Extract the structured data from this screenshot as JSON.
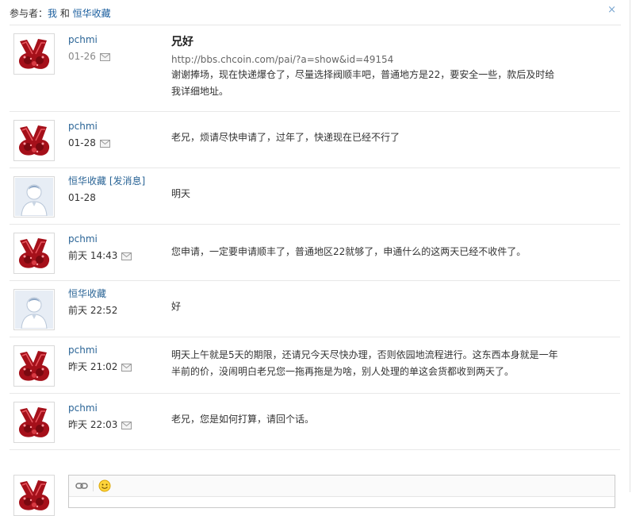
{
  "header": {
    "participants_label": "参与者：",
    "me": "我",
    "and": " 和 ",
    "other": "恒华收藏",
    "close_symbol": "×"
  },
  "messages": [
    {
      "sender": "pchmi",
      "date": "01-26",
      "subject": "兄好",
      "link": "http://bbs.chcoin.com/pai/?a=show&id=49154",
      "text_lines": [
        "谢谢捧场，现在快递爆仓了，尽量选择阀顺丰吧，普通地方是22，要安全一些，款后及时给",
        "我详细地址。"
      ],
      "avatar": "hand-avatar"
    },
    {
      "sender": "pchmi",
      "date": "01-28",
      "text_lines": [
        "老兄，烦请尽快申请了，过年了，快递现在已经不行了"
      ],
      "avatar": "hand-avatar"
    },
    {
      "sender": "恒华收藏",
      "send_link": " [发消息]",
      "date": "01-28",
      "text_lines": [
        "明天"
      ],
      "avatar": "default-avatar"
    },
    {
      "sender": "pchmi",
      "date": "前天 14:43",
      "text_lines": [
        "您申请，一定要申请顺丰了，普通地区22就够了，申通什么的这两天已经不收件了。"
      ],
      "avatar": "hand-avatar"
    },
    {
      "sender": "恒华收藏",
      "date": "前天 22:52",
      "text_lines": [
        "好"
      ],
      "avatar": "default-avatar"
    },
    {
      "sender": "pchmi",
      "date": "昨天 21:02",
      "text_lines": [
        "明天上午就是5天的期限，还请兄今天尽快办理，否则依园地流程进行。这东西本身就是一年",
        "半前的价，没闹明白老兄您一拖再拖是为啥，别人处理的单这会货都收到两天了。"
      ],
      "avatar": "hand-avatar"
    },
    {
      "sender": "pchmi",
      "date": "昨天 22:03",
      "text_lines": [
        "老兄，您是如何打算，请回个话。"
      ],
      "avatar": "hand-avatar"
    }
  ],
  "composer": {
    "attach_icon": "attach-icon",
    "emoji_icon": "smiley-icon"
  },
  "colors": {
    "link": "#1a5e9e",
    "divider": "#e8e8e8",
    "avatar_red": "#b3121b"
  }
}
